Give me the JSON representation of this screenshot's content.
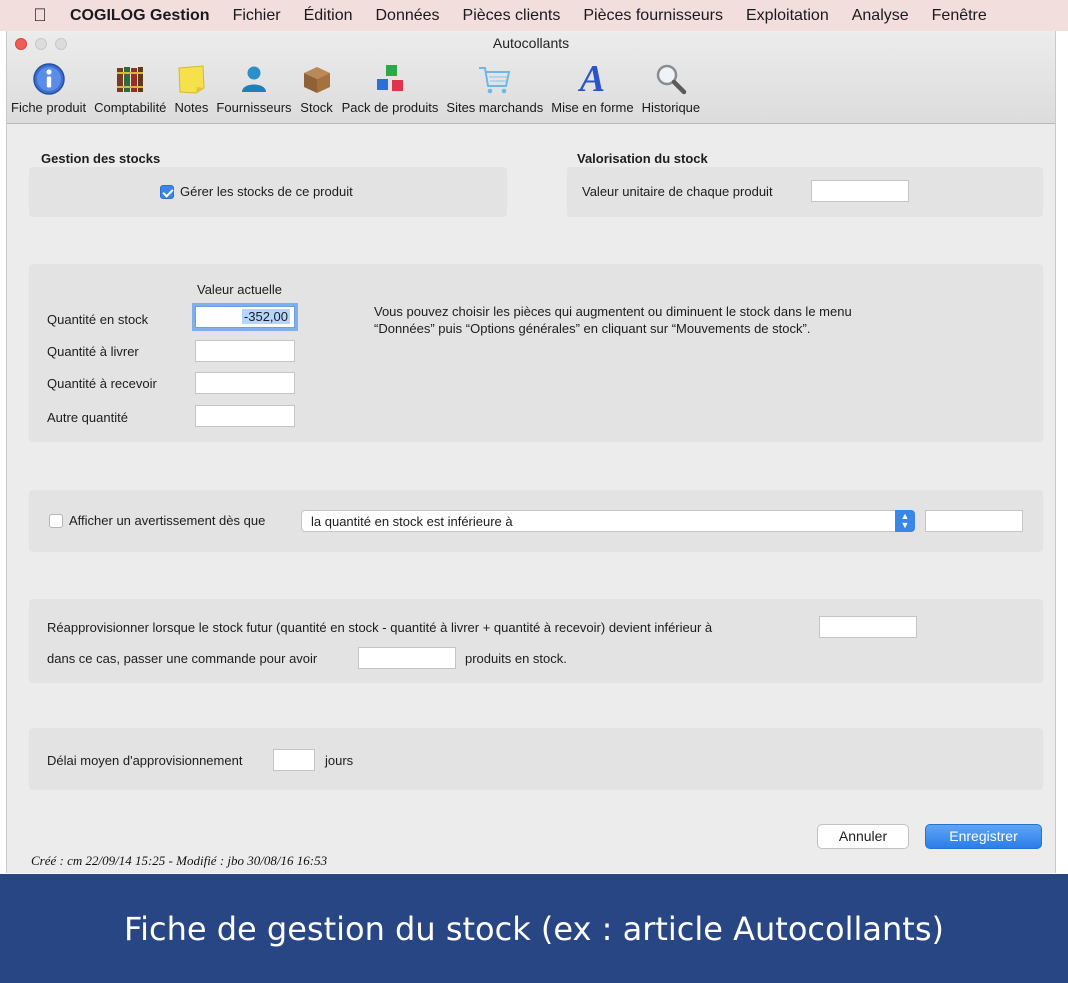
{
  "menubar": {
    "app": "COGILOG Gestion",
    "items": [
      "Fichier",
      "Édition",
      "Données",
      "Pièces clients",
      "Pièces fournisseurs",
      "Exploitation",
      "Analyse",
      "Fenêtre"
    ]
  },
  "window": {
    "title": "Autocollants"
  },
  "toolbar": {
    "items": [
      {
        "label": "Fiche produit",
        "icon": "info-icon"
      },
      {
        "label": "Comptabilité",
        "icon": "ledger-books-icon"
      },
      {
        "label": "Notes",
        "icon": "sticky-note-icon"
      },
      {
        "label": "Fournisseurs",
        "icon": "person-icon"
      },
      {
        "label": "Stock",
        "icon": "box-icon"
      },
      {
        "label": "Pack de produits",
        "icon": "cubes-icon"
      },
      {
        "label": "Sites marchands",
        "icon": "shopping-cart-icon"
      },
      {
        "label": "Mise en forme",
        "icon": "letter-a-icon"
      },
      {
        "label": "Historique",
        "icon": "magnifier-icon"
      }
    ]
  },
  "gestion": {
    "title": "Gestion des stocks",
    "checkbox_label": "Gérer les stocks de ce produit",
    "checked": true
  },
  "valorisation": {
    "title": "Valorisation du stock",
    "label": "Valeur unitaire de chaque produit",
    "value": ""
  },
  "quantites": {
    "column_header": "Valeur actuelle",
    "rows": [
      {
        "label": "Quantité en stock",
        "value": "-352,00"
      },
      {
        "label": "Quantité à livrer",
        "value": ""
      },
      {
        "label": "Quantité à recevoir",
        "value": ""
      },
      {
        "label": "Autre quantité",
        "value": ""
      }
    ],
    "info_line1": "Vous pouvez choisir les pièces qui augmentent ou diminuent le stock dans le menu",
    "info_line2": "“Données” puis “Options générales” en cliquant sur “Mouvements de stock”."
  },
  "avertissement": {
    "checkbox_label": "Afficher un avertissement dès que",
    "checked": false,
    "select_value": "la quantité en stock est inférieure à",
    "value": ""
  },
  "reappro": {
    "line1": "Réapprovisionner lorsque le stock futur (quantité en stock - quantité à livrer + quantité à recevoir) devient inférieur à",
    "line2_prefix": "dans ce cas, passer une commande pour avoir",
    "line2_suffix": "produits en stock.",
    "threshold": "",
    "order_qty": ""
  },
  "delai": {
    "label": "Délai moyen d'approvisionnement",
    "value": "",
    "unit": "jours"
  },
  "buttons": {
    "cancel": "Annuler",
    "save": "Enregistrer"
  },
  "meta": "Créé : cm 22/09/14 15:25 - Modifié : jbo 30/08/16 16:53",
  "caption": "Fiche de gestion du stock (ex : article Autocollants)",
  "colors": {
    "accent": "#3a86e8",
    "caption_bg": "#284683",
    "close_light": "#ee5e57"
  }
}
